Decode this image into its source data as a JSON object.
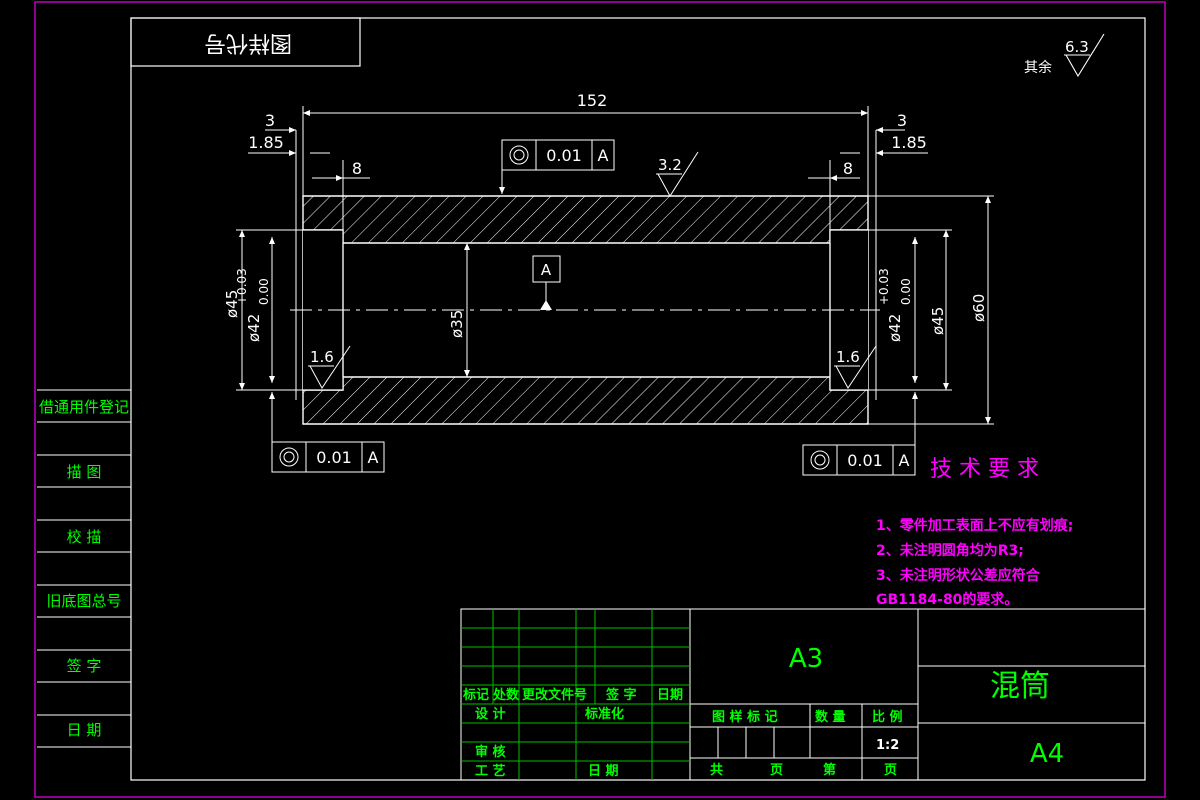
{
  "colors": {
    "background": "#000000",
    "frame": "#c000c0",
    "lines": "#ffffff",
    "table": "#00c000",
    "label_text": "#00ff00",
    "notes": "#ff00ff"
  },
  "header_box": {
    "label": "图样代号"
  },
  "surface_finish_other": {
    "label": "其余",
    "value": "6.3"
  },
  "dimensions": {
    "overall_length": "152",
    "left_step": "3",
    "left_offset": "1.85",
    "left_recess": "8",
    "right_step": "3",
    "right_offset": "1.85",
    "right_recess": "8",
    "top_roughness": "3.2",
    "left_roughness": "1.6",
    "right_roughness": "1.6",
    "dia_45_left": "ø45",
    "tol_upper_left": "+0.03",
    "tol_lower_left": "0.00",
    "dia_42_left": "ø42",
    "dia_35": "ø35",
    "dia_42_right": "ø42",
    "tol_upper_right": "+0.03",
    "tol_lower_right": "0.00",
    "dia_45_right": "ø45",
    "dia_60": "ø60",
    "datum": "A"
  },
  "tolerance_frames": {
    "top": {
      "value": "0.01",
      "datum": "A"
    },
    "bottom_left": {
      "value": "0.01",
      "datum": "A"
    },
    "bottom_right": {
      "value": "0.01",
      "datum": "A"
    }
  },
  "tech_requirements": {
    "title": "技 术 要 求",
    "items": [
      "1、零件加工表面上不应有划痕;",
      "2、未注明圆角均为R3;",
      "3、未注明形状公差应符合",
      "GB1184-80的要求。"
    ]
  },
  "side_table": {
    "rows": [
      "借通用件登记",
      "描  图",
      "校  描",
      "旧底图总号",
      "签  字",
      "日  期"
    ]
  },
  "title_block": {
    "format_a3": "A3",
    "part_name": "混筒",
    "format_a4": "A4",
    "rev_headers": [
      "标记",
      "处数",
      "更改文件号",
      "签 字",
      "日期"
    ],
    "design": "设 计",
    "standardize": "标准化",
    "review": "审 核",
    "process": "工 艺",
    "date": "日 期",
    "drawing_mark": "图 样 标 记",
    "quantity": "数 量",
    "scale_label": "比 例",
    "scale": "1:2",
    "total_label": "共",
    "sheet_unit": "页",
    "sheet_label": "第",
    "sheet_unit2": "页"
  }
}
